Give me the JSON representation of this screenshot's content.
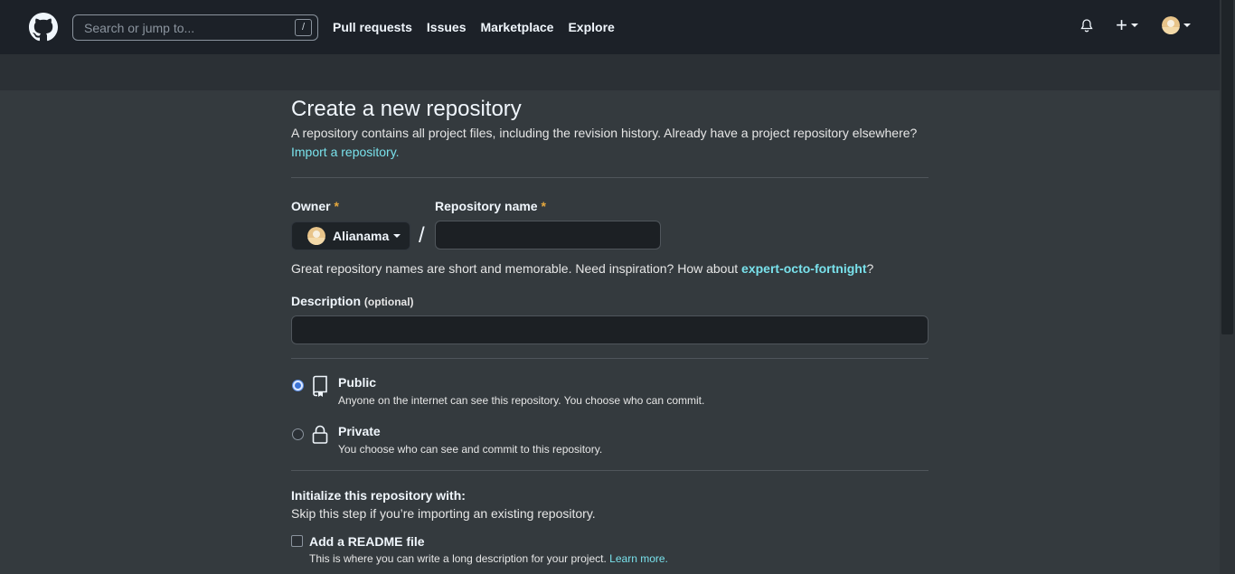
{
  "header": {
    "search_placeholder": "Search or jump to...",
    "search_shortcut": "/",
    "nav": [
      "Pull requests",
      "Issues",
      "Marketplace",
      "Explore"
    ],
    "plus_label": "+"
  },
  "page": {
    "title": "Create a new repository",
    "subtitle": "A repository contains all project files, including the revision history. Already have a project repository elsewhere?",
    "import_link": "Import a repository."
  },
  "form": {
    "owner_label": "Owner",
    "repo_label": "Repository name",
    "required_marker": "*",
    "owner_value": "Alianama",
    "slash": "/",
    "repo_value": "",
    "hint_prefix": "Great repository names are short and memorable. Need inspiration? How about ",
    "hint_suggestion": "expert-octo-fortnight",
    "hint_suffix": "?",
    "description_label": "Description",
    "description_optional": "(optional)",
    "description_value": ""
  },
  "visibility": {
    "options": [
      {
        "title": "Public",
        "desc": "Anyone on the internet can see this repository. You choose who can commit.",
        "selected": true
      },
      {
        "title": "Private",
        "desc": "You choose who can see and commit to this repository.",
        "selected": false
      }
    ]
  },
  "init": {
    "title": "Initialize this repository with:",
    "subtitle": "Skip this step if you’re importing an existing repository.",
    "readme_title": "Add a README file",
    "readme_desc": "This is where you can write a long description for your project.",
    "learn_more": "Learn more.",
    "readme_checked": false
  },
  "colors": {
    "accent_link": "#79e1eb",
    "required": "#e6a83d",
    "header_bg": "#1c2128",
    "page_bg": "#343a3e"
  }
}
